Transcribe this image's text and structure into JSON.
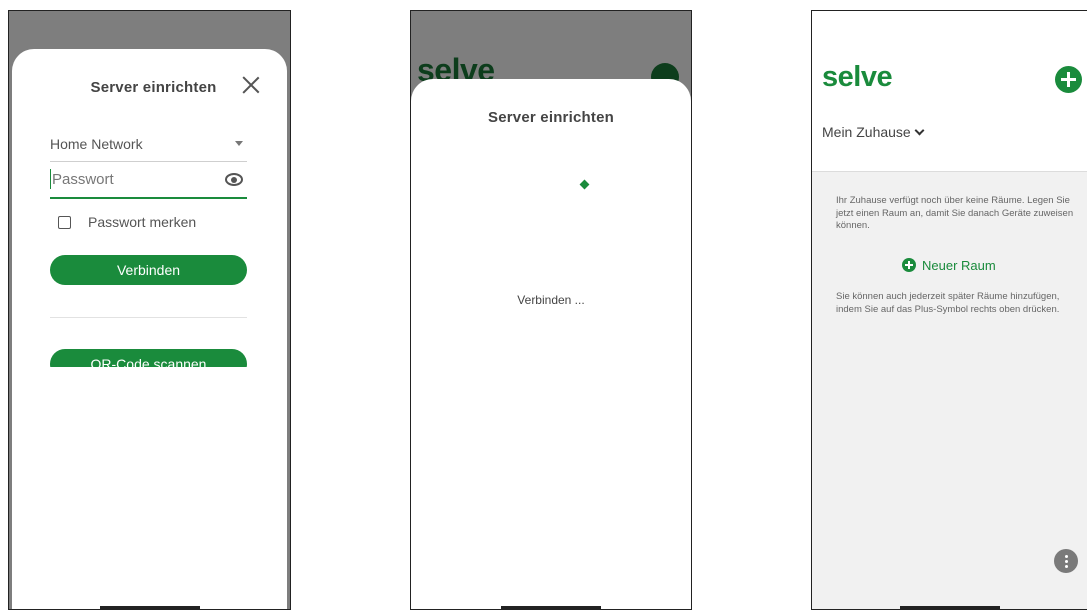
{
  "screen1": {
    "title": "Server einrichten",
    "network": "Home Network",
    "password_placeholder": "Passwort",
    "remember_label": "Passwort merken",
    "connect_button": "Verbinden",
    "qr_button": "QR-Code scannen"
  },
  "screen2": {
    "bg_logo": "selve",
    "title": "Server einrichten",
    "status": "Verbinden ..."
  },
  "screen3": {
    "logo": "selve",
    "home_selector": "Mein Zuhause",
    "info_empty": "Ihr Zuhause verfügt noch über keine Räume. Legen Sie jetzt einen Raum an, damit Sie danach Geräte zuweisen können.",
    "new_room": "Neuer Raum",
    "info_later": "Sie können auch jederzeit später Räume hinzufügen, indem Sie auf das Plus-Symbol rechts oben drücken."
  },
  "colors": {
    "brand_green": "#1a8b3c",
    "overlay": "#7e7e7e",
    "background": "#f1f1f1"
  },
  "icons": [
    "close-icon",
    "dropdown-caret-icon",
    "eye-icon",
    "checkbox-icon",
    "spinner-icon",
    "plus-circle-icon",
    "chevron-down-icon",
    "more-vert-icon"
  ]
}
